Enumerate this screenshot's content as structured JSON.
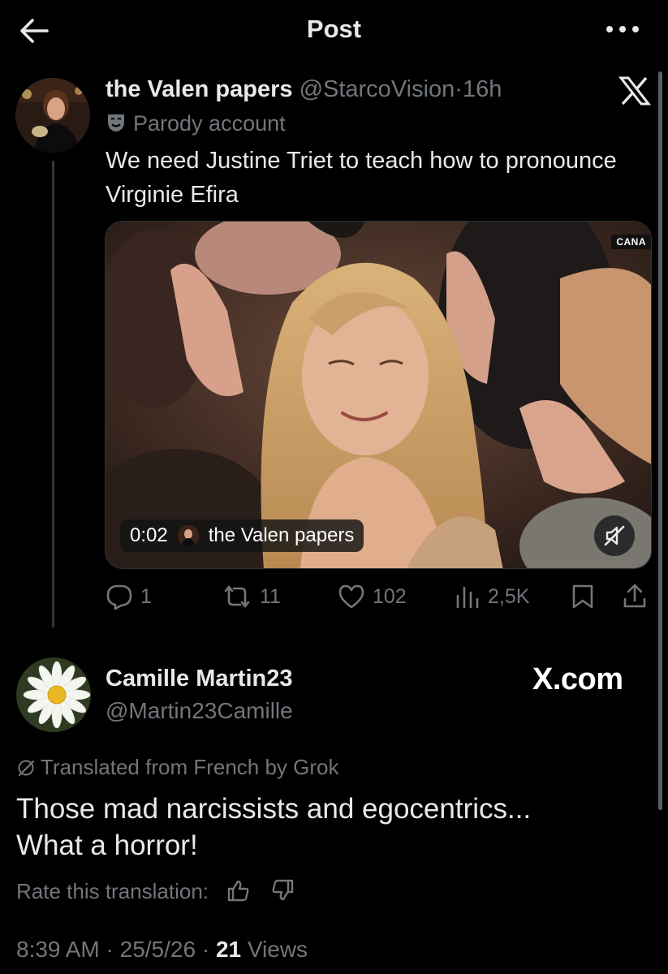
{
  "header": {
    "title": "Post",
    "back_icon": "arrow-left-icon",
    "more_icon": "more-horizontal-icon"
  },
  "post": {
    "author_name": "the Valen papers",
    "author_handle": "@StarcoVision",
    "separator": "·",
    "time": "16h",
    "label": "Parody account",
    "label_icon": "theater-masks-icon",
    "text": "We need Justine Triet to teach how to pronounce Virginie Efira",
    "media": {
      "type": "video",
      "timestamp": "0:02",
      "badge_name": "the Valen papers",
      "channel_tag": "CANA",
      "muted": true
    },
    "stats": {
      "replies": "1",
      "reposts": "11",
      "likes": "102",
      "views": "2,5K"
    }
  },
  "reply": {
    "author_name": "Camille Martin23",
    "author_handle": "@Martin23Camille",
    "watermark": "X.com",
    "translated_note": "Translated from French by Grok",
    "text_line1": "Those mad narcissists and egocentrics...",
    "text_line2": "What a horror!",
    "rate_label": "Rate this translation:",
    "time": "8:39 AM",
    "date": "25/5/26",
    "separator": "·",
    "views_count": "21",
    "views_label": "Views"
  },
  "colors": {
    "background": "#000000",
    "text": "#e7e9ea",
    "muted": "#71767b",
    "line": "#333639"
  }
}
